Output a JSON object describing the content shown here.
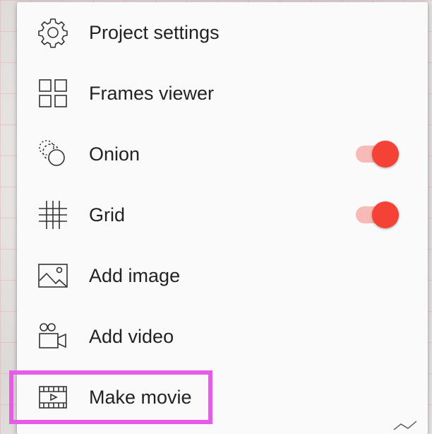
{
  "menu": {
    "items": [
      {
        "label": "Project settings",
        "icon": "gear-icon"
      },
      {
        "label": "Frames viewer",
        "icon": "grid-view-icon"
      },
      {
        "label": "Onion",
        "icon": "onion-layers-icon",
        "toggle": true
      },
      {
        "label": "Grid",
        "icon": "grid-icon",
        "toggle": true
      },
      {
        "label": "Add image",
        "icon": "image-icon"
      },
      {
        "label": "Add video",
        "icon": "video-camera-icon"
      },
      {
        "label": "Make movie",
        "icon": "film-icon"
      }
    ]
  },
  "colors": {
    "accent": "#f44336",
    "highlight": "#e75ce7",
    "menu_background": "#fafafa",
    "text": "#222222"
  }
}
